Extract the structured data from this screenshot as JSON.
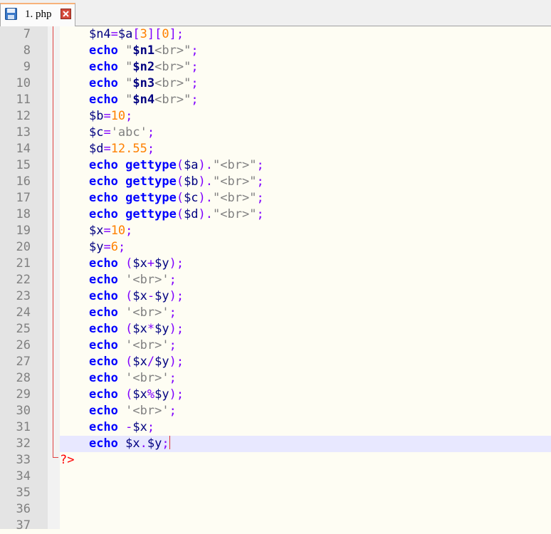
{
  "tab": {
    "label": "1. php"
  },
  "lines": [
    {
      "n": "7"
    },
    {
      "n": "8"
    },
    {
      "n": "9"
    },
    {
      "n": "10"
    },
    {
      "n": "11"
    },
    {
      "n": "12"
    },
    {
      "n": "13"
    },
    {
      "n": "14"
    },
    {
      "n": "15"
    },
    {
      "n": "16"
    },
    {
      "n": "17"
    },
    {
      "n": "18"
    },
    {
      "n": "19"
    },
    {
      "n": "20"
    },
    {
      "n": "21"
    },
    {
      "n": "22"
    },
    {
      "n": "23"
    },
    {
      "n": "24"
    },
    {
      "n": "25"
    },
    {
      "n": "26"
    },
    {
      "n": "27"
    },
    {
      "n": "28"
    },
    {
      "n": "29"
    },
    {
      "n": "30"
    },
    {
      "n": "31"
    },
    {
      "n": "32"
    },
    {
      "n": "33"
    },
    {
      "n": "34"
    },
    {
      "n": "35"
    },
    {
      "n": "36"
    },
    {
      "n": "37"
    }
  ],
  "code": {
    "l7": "    $n4=$a[3][0];",
    "echo": "echo",
    "gettype": "gettype",
    "n1": "$n1",
    "n2": "$n2",
    "n3": "$n3",
    "n4": "$n4",
    "br": "<br>",
    "b": "$b",
    "c": "$c",
    "d": "$d",
    "x": "$x",
    "y": "$y",
    "ten": "10",
    "six": "6",
    "abc": "'abc'",
    "d_val": "12.55",
    "close_tag": "?>"
  },
  "colors": {
    "keyword": "#0000ff",
    "variable": "#000080",
    "number": "#ff8000",
    "string": "#808080",
    "operator": "#8000ff",
    "tag": "#ff0000"
  }
}
